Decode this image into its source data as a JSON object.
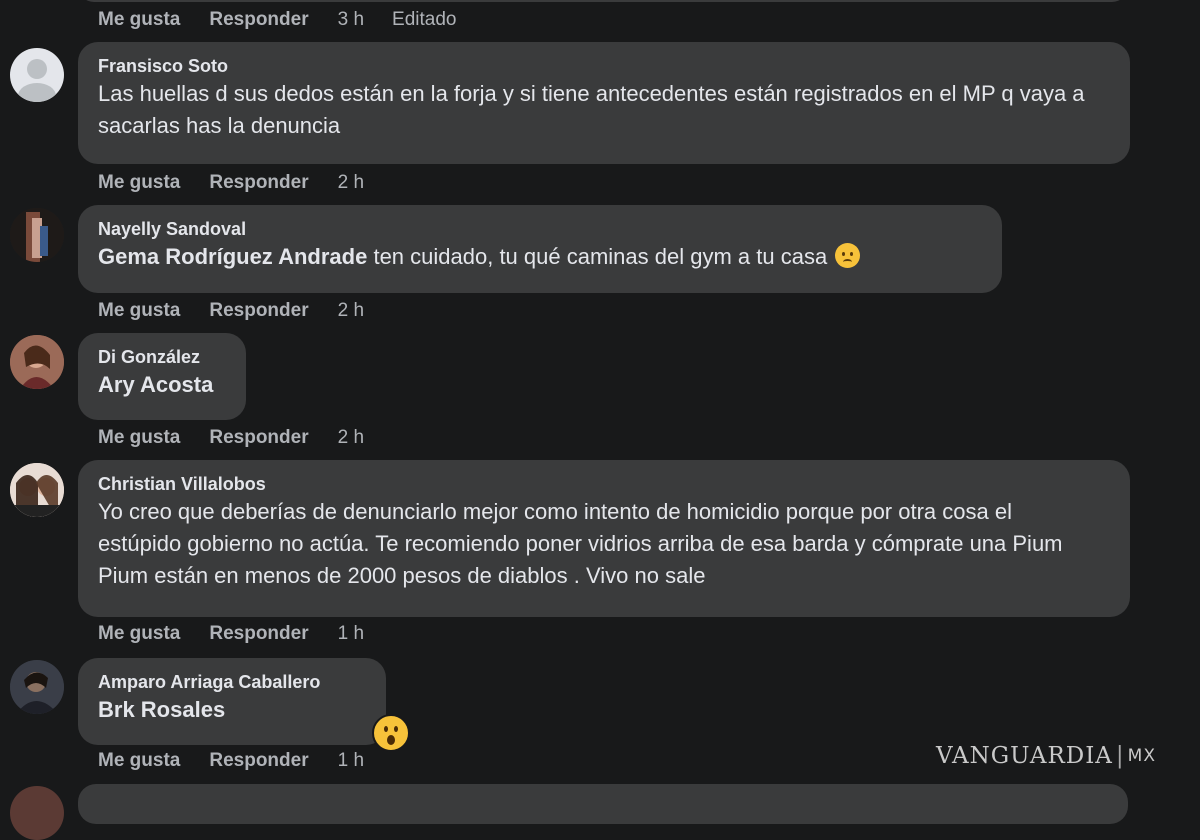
{
  "top_actions": {
    "like": "Me gusta",
    "reply": "Responder",
    "time": "3 h",
    "edited": "Editado"
  },
  "comments": [
    {
      "author": "Fransisco Soto",
      "text": "Las huellas d sus dedos están en la forja y si tiene antecedentes están registrados en el MP q vaya a sacarlas has la denuncia",
      "like": "Me gusta",
      "reply": "Responder",
      "time": "2 h",
      "avatar": "default-avatar-icon"
    },
    {
      "author": "Nayelly Sandoval",
      "mention": "Gema Rodríguez Andrade",
      "text": " ten cuidado, tu qué caminas del gym a tu casa",
      "emoji": "worried-face-icon",
      "like": "Me gusta",
      "reply": "Responder",
      "time": "2 h"
    },
    {
      "author": "Di González",
      "mention": "Ary Acosta",
      "like": "Me gusta",
      "reply": "Responder",
      "time": "2 h"
    },
    {
      "author": "Christian Villalobos",
      "text": "Yo creo que deberías de denunciarlo mejor como intento de homicidio porque por otra cosa el estúpido gobierno no actúa. Te recomiendo poner vidrios arriba de esa barda y cómprate una Pium Pium están en menos de 2000 pesos de diablos . Vivo no sale",
      "like": "Me gusta",
      "reply": "Responder",
      "time": "1 h"
    },
    {
      "author": "Amparo Arriaga Caballero",
      "mention": "Brk Rosales",
      "reaction": "wow-reaction-icon",
      "like": "Me gusta",
      "reply": "Responder",
      "time": "1 h"
    }
  ],
  "watermark": {
    "brand": "VANGUARDIA",
    "sep": "|",
    "country": "MX"
  },
  "colors": {
    "background": "#18191a",
    "bubble": "#3a3b3c",
    "text": "#e4e6eb",
    "meta": "#b0b3b8"
  }
}
